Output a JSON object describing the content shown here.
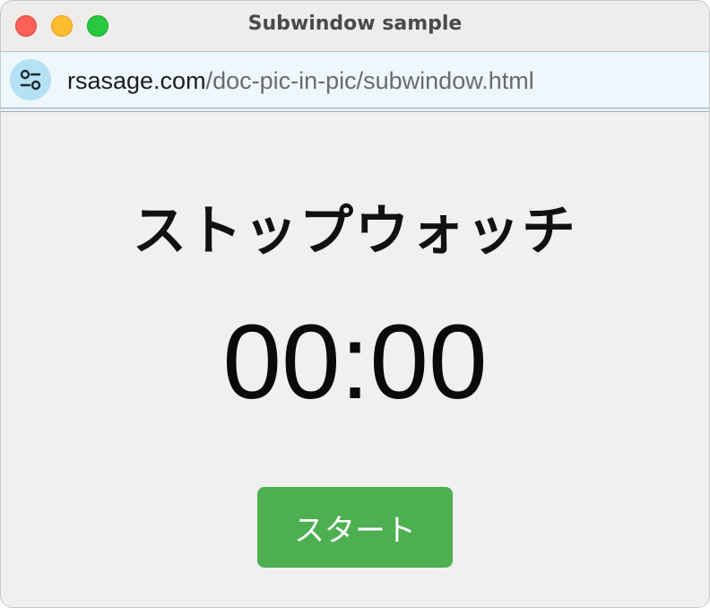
{
  "window": {
    "title": "Subwindow sample"
  },
  "urlbar": {
    "domain": "rsasage.com",
    "path": "/doc-pic-in-pic/subwindow.html",
    "site_info_icon": "sliders-icon"
  },
  "main": {
    "heading": "ストップウォッチ",
    "timer": "00:00",
    "start_label": "スタート"
  },
  "colors": {
    "close": "#fe5f57",
    "minimize": "#febc2e",
    "zoom": "#28c840",
    "start_button": "#4caf50",
    "urlbar_bg": "#eef7fb"
  }
}
